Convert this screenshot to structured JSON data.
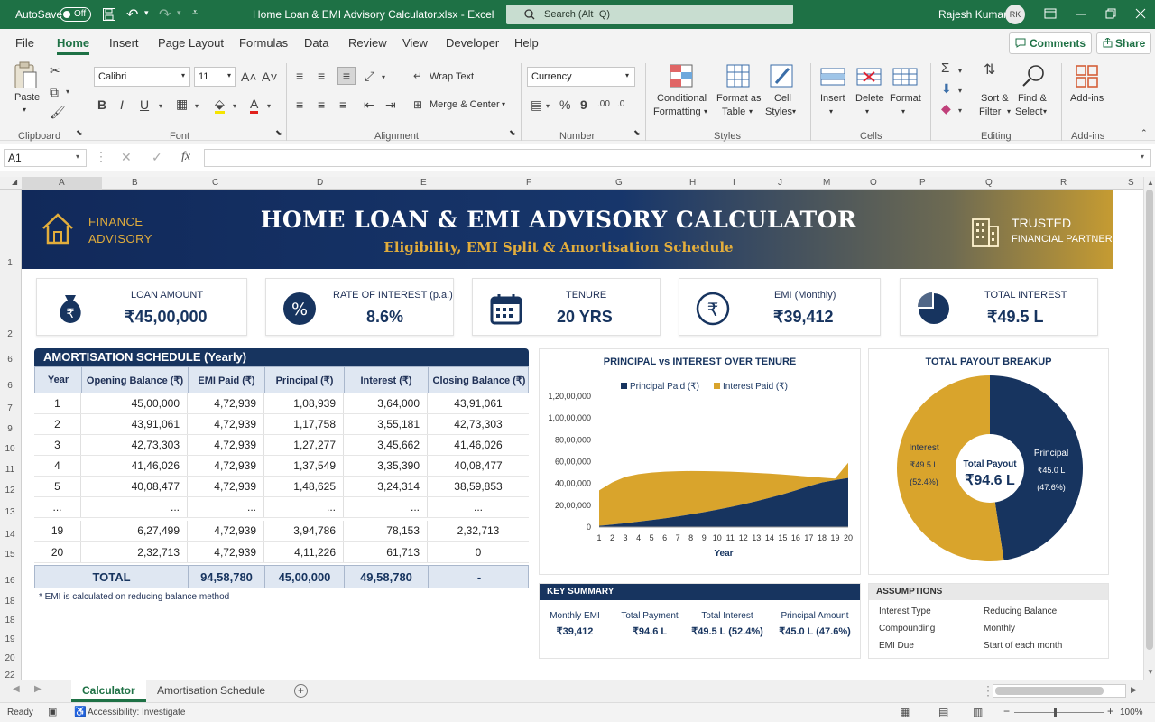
{
  "window": {
    "autosave_label": "AutoSave",
    "autosave_state": "Off",
    "title": "Home Loan & EMI Advisory Calculator.xlsx  -  Excel",
    "search_placeholder": "Search (Alt+Q)",
    "user_name": "Rajesh Kumar",
    "user_initials": "RK"
  },
  "menu": {
    "items": [
      "File",
      "Home",
      "Insert",
      "Page Layout",
      "Formulas",
      "Data",
      "Review",
      "View",
      "Developer",
      "Help"
    ],
    "active": "Home",
    "comments": "Comments",
    "share": "Share"
  },
  "ribbon": {
    "paste": "Paste",
    "font_name": "Calibri",
    "font_size": "11",
    "wrap_text": "Wrap Text",
    "merge_center": "Merge & Center",
    "number_format": "Currency",
    "conditional_formatting": [
      "Conditional",
      "Formatting"
    ],
    "format_as_table": [
      "Format as",
      "Table"
    ],
    "cell_styles": [
      "Cell",
      "Styles"
    ],
    "insert": "Insert",
    "delete": "Delete",
    "format": "Format",
    "sort_filter": [
      "Sort &",
      "Filter"
    ],
    "find_select": [
      "Find &",
      "Select"
    ],
    "add_ins": "Add-ins",
    "groups": {
      "clipboard": "Clipboard",
      "font": "Font",
      "alignment": "Alignment",
      "number": "Number",
      "styles": "Styles",
      "cells": "Cells",
      "editing": "Editing",
      "addins": "Add-ins"
    }
  },
  "formula_bar": {
    "name_box": "A1",
    "fx": "fx",
    "formula": ""
  },
  "columns": [
    "A",
    "B",
    "C",
    "D",
    "E",
    "F",
    "G",
    "H",
    "I",
    "J",
    "K",
    "M",
    "N",
    "O",
    "P",
    "Q",
    "R",
    "S"
  ],
  "rows": [
    "1",
    "2",
    "6",
    "6",
    "7",
    "9",
    "10",
    "11",
    "12",
    "13",
    "14",
    "15",
    "16",
    "18",
    "18",
    "19",
    "20",
    "22"
  ],
  "banner": {
    "left_line1": "FINANCE",
    "left_line2": "ADVISORY",
    "title": "HOME LOAN & EMI ADVISORY CALCULATOR",
    "subtitle": "Eligibility, EMI Split & Amortisation Schedule",
    "right_line1": "TRUSTED",
    "right_line2": "FINANCIAL PARTNER"
  },
  "cards": [
    {
      "label": "LOAN AMOUNT",
      "value": "₹45,00,000",
      "icon": "money-bag-icon"
    },
    {
      "label": "RATE OF INTEREST (p.a.)",
      "value": "8.6%",
      "icon": "percent-icon"
    },
    {
      "label": "TENURE",
      "value": "20 YRS",
      "icon": "calendar-icon"
    },
    {
      "label": "EMI (Monthly)",
      "value": "₹39,412",
      "icon": "rupee-icon"
    },
    {
      "label": "TOTAL INTEREST",
      "value": "₹49.5 L",
      "icon": "pie-icon"
    }
  ],
  "amortisation": {
    "title": "AMORTISATION SCHEDULE (Yearly)",
    "headers": [
      "Year",
      "Opening Balance (₹)",
      "EMI Paid (₹)",
      "Principal (₹)",
      "Interest (₹)",
      "Closing Balance (₹)"
    ],
    "rows": [
      [
        "1",
        "45,00,000",
        "4,72,939",
        "1,08,939",
        "3,64,000",
        "43,91,061"
      ],
      [
        "2",
        "43,91,061",
        "4,72,939",
        "1,17,758",
        "3,55,181",
        "42,73,303"
      ],
      [
        "3",
        "42,73,303",
        "4,72,939",
        "1,27,277",
        "3,45,662",
        "41,46,026"
      ],
      [
        "4",
        "41,46,026",
        "4,72,939",
        "1,37,549",
        "3,35,390",
        "40,08,477"
      ],
      [
        "5",
        "40,08,477",
        "4,72,939",
        "1,48,625",
        "3,24,314",
        "38,59,853"
      ],
      [
        "...",
        "...",
        "...",
        "...",
        "...",
        "..."
      ],
      [
        "19",
        "6,27,499",
        "4,72,939",
        "3,94,786",
        "78,153",
        "2,32,713"
      ],
      [
        "20",
        "2,32,713",
        "4,72,939",
        "4,11,226",
        "61,713",
        "0"
      ]
    ],
    "total": [
      "TOTAL",
      "94,58,780",
      "45,00,000",
      "49,58,780",
      "-"
    ],
    "footnote": "* EMI is calculated on reducing balance method"
  },
  "chart_data": [
    {
      "type": "area",
      "title": "PRINCIPAL vs INTEREST OVER TENURE",
      "xlabel": "Year",
      "ylabel": "",
      "x": [
        1,
        2,
        3,
        4,
        5,
        6,
        7,
        8,
        9,
        10,
        11,
        12,
        13,
        14,
        15,
        16,
        17,
        18,
        19,
        20
      ],
      "yticks": [
        "0",
        "20,00,000",
        "40,00,000",
        "60,00,000",
        "80,00,000",
        "1,00,00,000",
        "1,20,00,000"
      ],
      "ylim": [
        0,
        12000000
      ],
      "stacked": true,
      "legend": "top",
      "series": [
        {
          "name": "Principal Paid (₹)",
          "color": "#17345f",
          "values": [
            108939,
            226697,
            353974,
            491523,
            640148,
            800000,
            975000,
            1165000,
            1370000,
            1592000,
            1832000,
            2092000,
            2372000,
            2676000,
            3005000,
            3362000,
            3748000,
            4090000,
            4300000,
            4500000
          ]
        },
        {
          "name": "Interest Paid (₹)",
          "color": "#d9a42c",
          "values": [
            3364000,
            4100000,
            4600000,
            4850000,
            5000000,
            5080000,
            5120000,
            5140000,
            5130000,
            5110000,
            5080000,
            5030000,
            4970000,
            4900000,
            4820000,
            4730000,
            4620000,
            4530000,
            4450000,
            5900000
          ]
        }
      ]
    },
    {
      "type": "pie",
      "title": "TOTAL PAYOUT BREAKUP",
      "center_label": "Total Payout",
      "center_value": "₹94.6 L",
      "slices": [
        {
          "name": "Principal",
          "value_label": "₹45.0 L",
          "pct_label": "(47.6%)",
          "value": 47.6,
          "color": "#17345f"
        },
        {
          "name": "Interest",
          "value_label": "₹49.5 L",
          "pct_label": "(52.4%)",
          "value": 52.4,
          "color": "#d9a42c"
        }
      ]
    }
  ],
  "key_summary": {
    "title": "KEY SUMMARY",
    "items": [
      {
        "label": "Monthly EMI",
        "value": "₹39,412"
      },
      {
        "label": "Total Payment",
        "value": "₹94.6 L"
      },
      {
        "label": "Total Interest",
        "value": "₹49.5 L (52.4%)"
      },
      {
        "label": "Principal Amount",
        "value": "₹45.0 L (47.6%)"
      }
    ]
  },
  "assumptions": {
    "title": "ASSUMPTIONS",
    "items": [
      {
        "label": "Interest Type",
        "value": "Reducing Balance"
      },
      {
        "label": "Compounding",
        "value": "Monthly"
      },
      {
        "label": "EMI Due",
        "value": "Start of each month"
      }
    ]
  },
  "sheet_tabs": {
    "tabs": [
      "Calculator",
      "Amortisation Schedule"
    ],
    "active": "Calculator"
  },
  "status": {
    "ready": "Ready",
    "accessibility": "Accessibility: Investigate",
    "zoom": "100%"
  }
}
